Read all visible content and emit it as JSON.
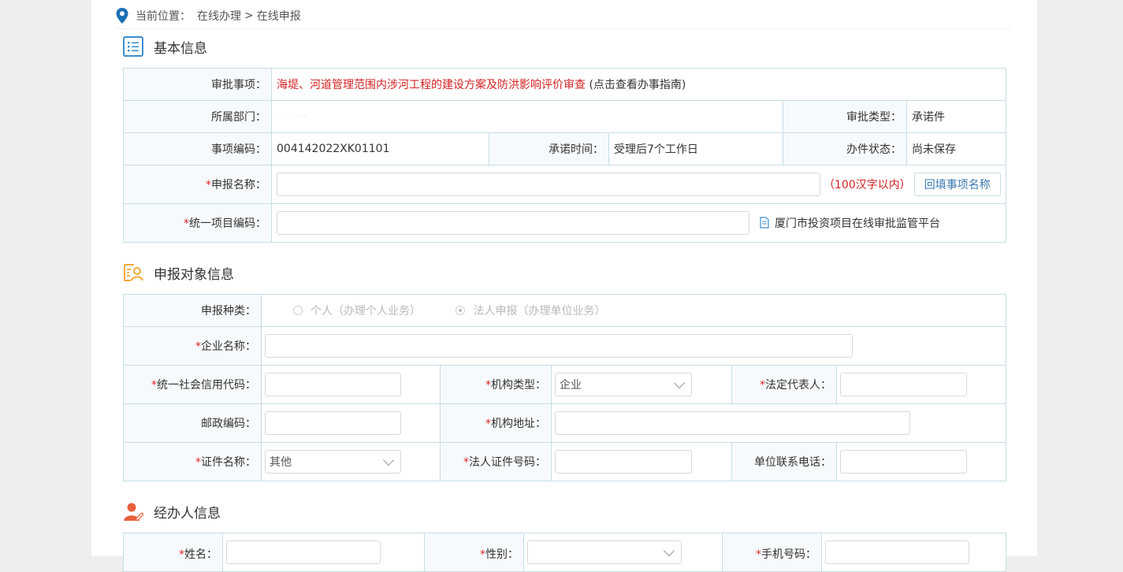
{
  "breadcrumb": {
    "label": "当前位置：",
    "path1": "在线办理",
    "sep": ">",
    "path2": "在线申报"
  },
  "basic": {
    "title": "基本信息",
    "item_label": "审批事项：",
    "item_value": "海堤、河道管理范围内涉河工程的建设方案及防洪影响评价审查",
    "item_guide": "(点击查看办事指南)",
    "dept_label": "所属部门：",
    "dept_value": "· · ····",
    "type_label": "审批类型：",
    "type_value": "承诺件",
    "code_label": "事项编码：",
    "code_value": "004142022XK01101",
    "time_label": "承诺时间：",
    "time_value": "受理后7个工作日",
    "status_label": "办件状态：",
    "status_value": "尚未保存",
    "name_label": "申报名称：",
    "name_hint": "（100汉字以内）",
    "name_button": "回填事项名称",
    "proj_label": "统一项目编码：",
    "proj_link": "厦门市投资项目在线审批监管平台"
  },
  "applicant": {
    "title": "申报对象信息",
    "kind_label": "申报种类：",
    "kind_person": "个人（办理个人业务）",
    "kind_corp": "法人申报（办理单位业务）",
    "company_label": "企业名称：",
    "credit_label": "统一社会信用代码：",
    "org_type_label": "机构类型：",
    "org_type_value": "企业",
    "legal_rep_label": "法定代表人：",
    "zip_label": "邮政编码：",
    "org_addr_label": "机构地址：",
    "cert_name_label": "证件名称：",
    "cert_name_value": "其他",
    "legal_cert_label": "法人证件号码：",
    "phone_label": "单位联系电话："
  },
  "handler": {
    "title": "经办人信息",
    "name_label": "姓名：",
    "gender_label": "性别：",
    "mobile_label": "手机号码："
  },
  "colors": {
    "accent": "#3a78b0",
    "required": "#e02424",
    "border": "#c6dde6",
    "label_bg": "#f7fafd",
    "icon_orange": "#f2a93b",
    "icon_blue": "#3d8ed0",
    "icon_red": "#e8603c"
  }
}
